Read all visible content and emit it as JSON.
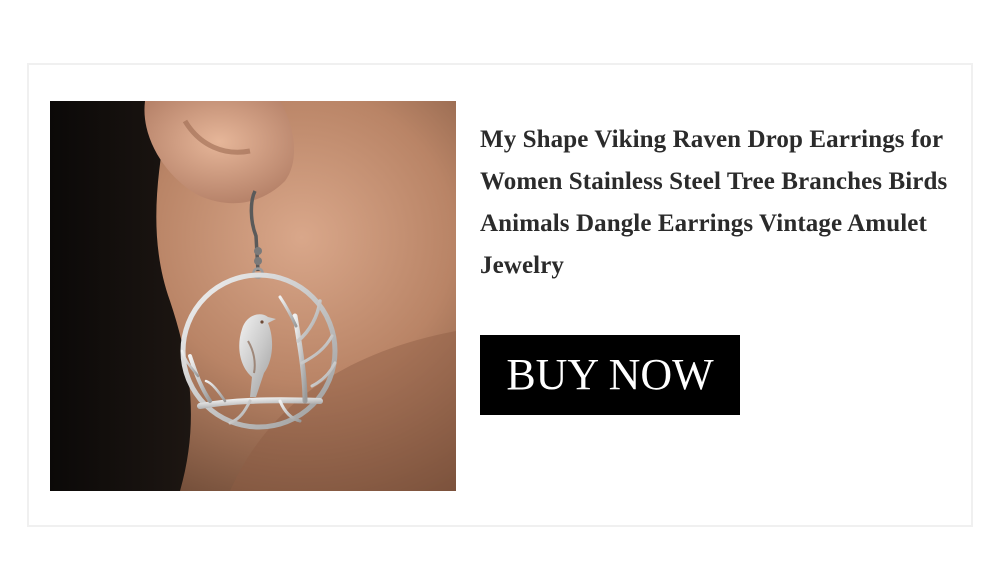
{
  "product": {
    "title": "My Shape Viking Raven Drop Earrings for Women Stainless Steel Tree Branches Birds Animals Dangle Earrings Vintage Amulet Jewelry",
    "buy_label": "BUY NOW"
  },
  "colors": {
    "button_bg": "#000000",
    "button_text": "#ffffff",
    "title_text": "#2b2b2b",
    "card_border": "#f0f0f0"
  }
}
